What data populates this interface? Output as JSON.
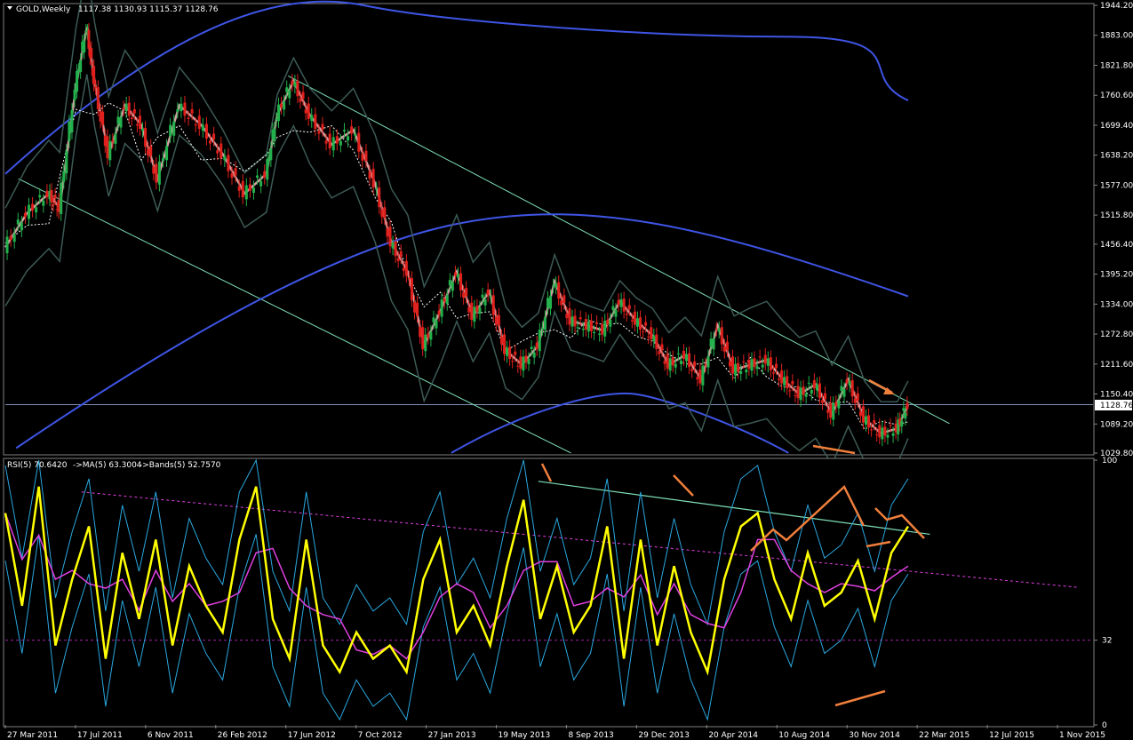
{
  "chart_data": [
    {
      "type": "candlestick",
      "symbol": "GOLD,Weekly",
      "ohlc": "1117.38 1130.93 1115.37 1128.76",
      "last_price_label": "1128.76",
      "last_price": 1128.76,
      "ylim": [
        1029.8,
        1944.2
      ],
      "y_ticks": [
        "1944.20",
        "1883.00",
        "1821.80",
        "1760.60",
        "1699.40",
        "1638.20",
        "1577.00",
        "1515.80",
        "1456.40",
        "1395.20",
        "1334.00",
        "1272.80",
        "1211.60",
        "1150.40",
        "1089.20",
        "1029.80"
      ],
      "grid": false,
      "colors": {
        "bull": "#22b14c",
        "bear": "#e0201c",
        "ma_fast": "#d19fa0",
        "ma_slow": "#ffffff",
        "envelope": "#3c5a55",
        "channel": "#7fe0b8",
        "long_ma": "#3f55e6",
        "price_line": "#7f8fb0",
        "annotation": "#f07f3c"
      },
      "price_path": [
        {
          "x": 0.0,
          "y": 1450
        },
        {
          "x": 0.02,
          "y": 1520
        },
        {
          "x": 0.04,
          "y": 1560
        },
        {
          "x": 0.05,
          "y": 1530
        },
        {
          "x": 0.065,
          "y": 1780
        },
        {
          "x": 0.075,
          "y": 1900
        },
        {
          "x": 0.082,
          "y": 1790
        },
        {
          "x": 0.095,
          "y": 1640
        },
        {
          "x": 0.11,
          "y": 1740
        },
        {
          "x": 0.125,
          "y": 1700
        },
        {
          "x": 0.14,
          "y": 1590
        },
        {
          "x": 0.16,
          "y": 1740
        },
        {
          "x": 0.18,
          "y": 1700
        },
        {
          "x": 0.2,
          "y": 1640
        },
        {
          "x": 0.22,
          "y": 1560
        },
        {
          "x": 0.24,
          "y": 1600
        },
        {
          "x": 0.25,
          "y": 1720
        },
        {
          "x": 0.265,
          "y": 1790
        },
        {
          "x": 0.28,
          "y": 1720
        },
        {
          "x": 0.3,
          "y": 1660
        },
        {
          "x": 0.32,
          "y": 1690
        },
        {
          "x": 0.34,
          "y": 1580
        },
        {
          "x": 0.355,
          "y": 1460
        },
        {
          "x": 0.37,
          "y": 1400
        },
        {
          "x": 0.385,
          "y": 1250
        },
        {
          "x": 0.4,
          "y": 1320
        },
        {
          "x": 0.415,
          "y": 1400
        },
        {
          "x": 0.43,
          "y": 1310
        },
        {
          "x": 0.445,
          "y": 1360
        },
        {
          "x": 0.46,
          "y": 1240
        },
        {
          "x": 0.475,
          "y": 1210
        },
        {
          "x": 0.49,
          "y": 1250
        },
        {
          "x": 0.505,
          "y": 1380
        },
        {
          "x": 0.52,
          "y": 1300
        },
        {
          "x": 0.535,
          "y": 1290
        },
        {
          "x": 0.55,
          "y": 1280
        },
        {
          "x": 0.565,
          "y": 1340
        },
        {
          "x": 0.58,
          "y": 1300
        },
        {
          "x": 0.595,
          "y": 1270
        },
        {
          "x": 0.61,
          "y": 1210
        },
        {
          "x": 0.625,
          "y": 1230
        },
        {
          "x": 0.64,
          "y": 1180
        },
        {
          "x": 0.655,
          "y": 1290
        },
        {
          "x": 0.67,
          "y": 1200
        },
        {
          "x": 0.685,
          "y": 1210
        },
        {
          "x": 0.7,
          "y": 1220
        },
        {
          "x": 0.715,
          "y": 1180
        },
        {
          "x": 0.73,
          "y": 1150
        },
        {
          "x": 0.745,
          "y": 1170
        },
        {
          "x": 0.76,
          "y": 1110
        },
        {
          "x": 0.775,
          "y": 1180
        },
        {
          "x": 0.79,
          "y": 1100
        },
        {
          "x": 0.805,
          "y": 1070
        },
        {
          "x": 0.82,
          "y": 1080
        },
        {
          "x": 0.83,
          "y": 1128
        }
      ],
      "annotations": [
        "arrow-down-right",
        "arrow-right"
      ]
    },
    {
      "type": "line",
      "title": "RSI(5) 70.6420",
      "legend": [
        "RSI(5) 70.6420",
        "->MA(5) 63.3004",
        "->Bands(5) 52.7570"
      ],
      "ylim": [
        0,
        100
      ],
      "y_ticks": [
        "100",
        "32",
        "0"
      ],
      "levels": [
        32
      ],
      "grid": false,
      "colors": {
        "rsi": "#ffff00",
        "ma": "#e040e0",
        "bands": "#2aa8e0",
        "trend": "#7fe0b8",
        "level": "#a020a0",
        "annotation": "#f07f3c"
      },
      "series": [
        {
          "values": [
            80,
            45,
            90,
            30,
            55,
            75,
            25,
            65,
            40,
            70,
            30,
            60,
            45,
            35,
            70,
            90,
            40,
            25,
            70,
            30,
            20,
            35,
            25,
            30,
            20,
            55,
            70,
            35,
            45,
            30,
            60,
            85,
            40,
            60,
            35,
            45,
            75,
            25,
            70,
            30,
            60,
            35,
            20,
            55,
            75,
            80,
            55,
            40,
            65,
            45,
            50,
            62,
            40,
            65,
            75
          ]
        }
      ]
    }
  ],
  "x_labels": [
    "27 Mar 2011",
    "17 Jul 2011",
    "6 Nov 2011",
    "26 Feb 2012",
    "17 Jun 2012",
    "7 Oct 2012",
    "27 Jan 2013",
    "19 May 2013",
    "8 Sep 2013",
    "29 Dec 2013",
    "20 Apr 2014",
    "10 Aug 2014",
    "30 Nov 2014",
    "22 Mar 2015",
    "12 Jul 2015",
    "1 Nov 2015"
  ]
}
